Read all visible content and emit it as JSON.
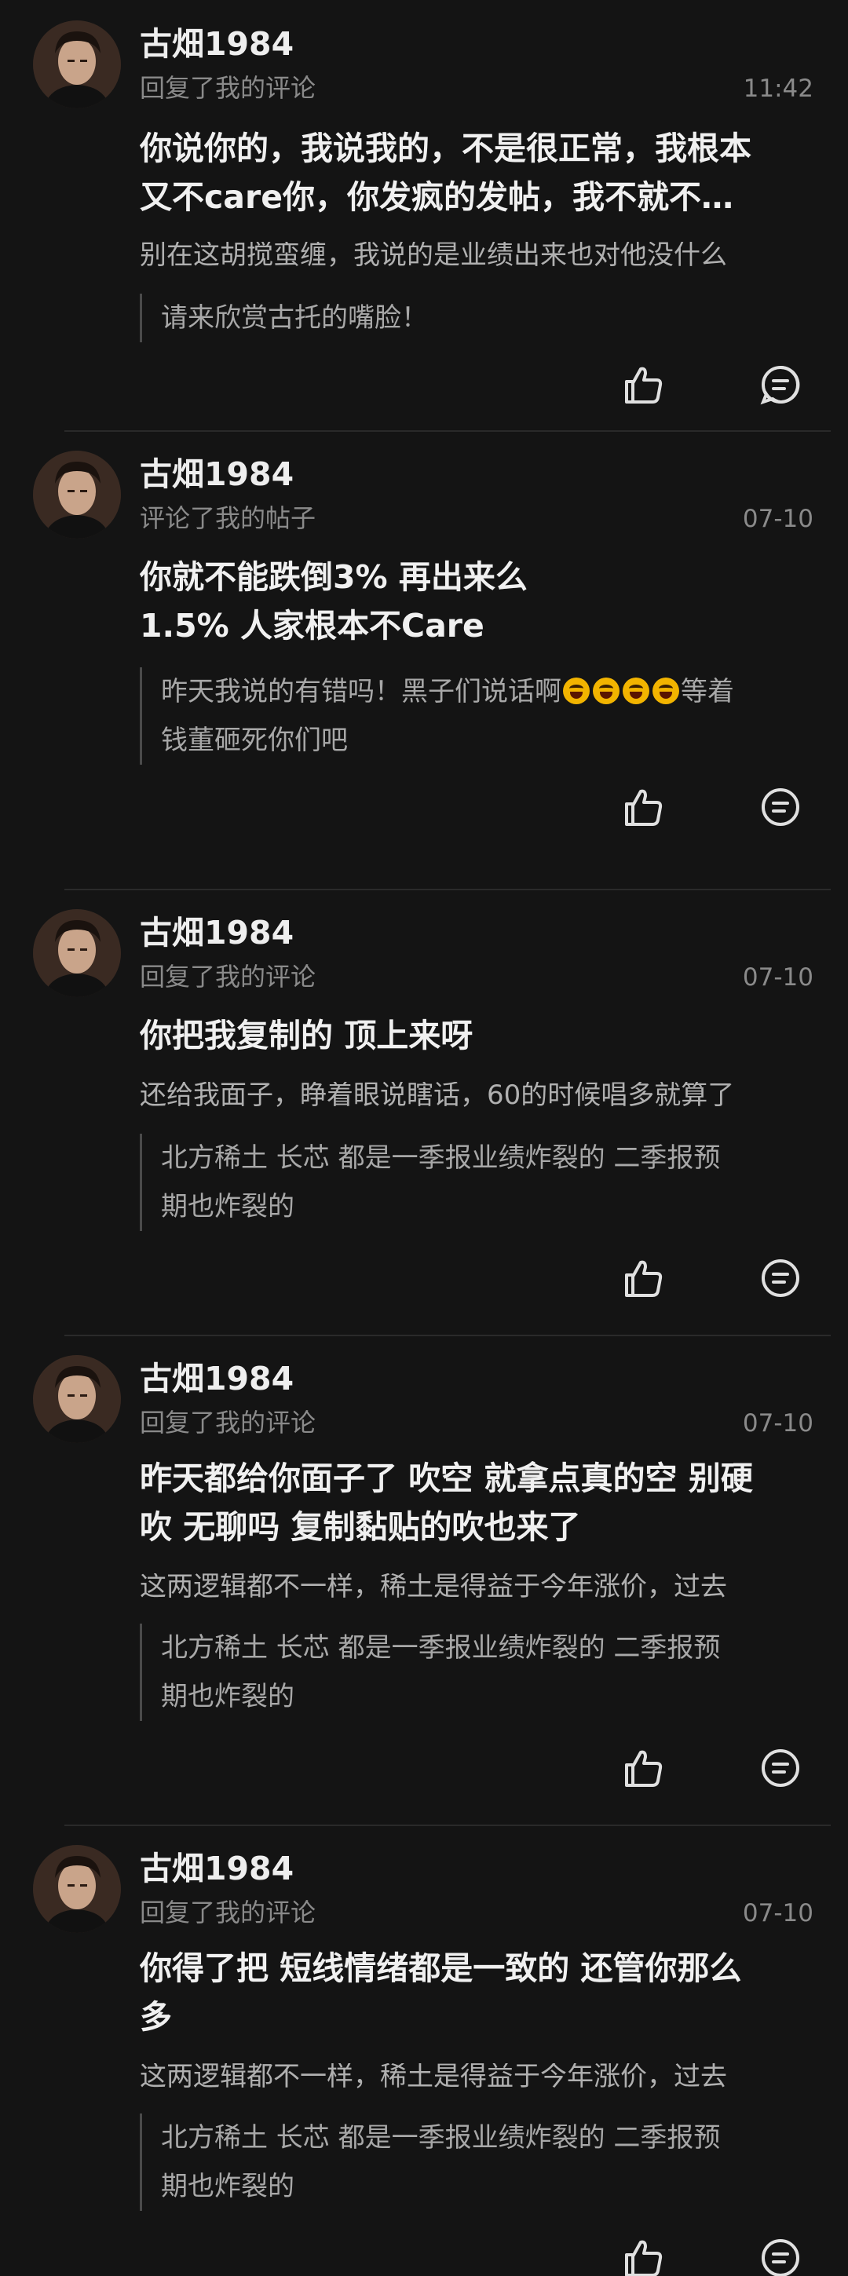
{
  "comments": [
    {
      "username": "古畑1984",
      "action": "回复了我的评论",
      "time": "11:42",
      "main_lines": [
        "你说你的，我说我的，不是很正常，我根本",
        "又不care你，你发疯的发帖，我不就不…"
      ],
      "context": "别在这胡搅蛮缠，我说的是业绩出来也对他没什么",
      "quote_lines": [
        "请来欣赏古托的嘴脸！"
      ]
    },
    {
      "username": "古畑1984",
      "action": "评论了我的帖子",
      "time": "07-10",
      "main_lines": [
        "你就不能跌倒3% 再出来么",
        "1.5% 人家根本不Care"
      ],
      "context": "",
      "quote_line1_text": "昨天我说的有错吗！黑子们说话啊",
      "quote_line1_tail": "等着",
      "quote_lines": [
        "昨天我说的有错吗！黑子们说话啊等着",
        "钱董砸死你们吧"
      ]
    },
    {
      "username": "古畑1984",
      "action": "回复了我的评论",
      "time": "07-10",
      "main_lines": [
        "你把我复制的 顶上来呀"
      ],
      "context": "还给我面子，睁着眼说瞎话，60的时候唱多就算了",
      "quote_lines": [
        "北方稀土 长芯 都是一季报业绩炸裂的 二季报预",
        "期也炸裂的"
      ]
    },
    {
      "username": "古畑1984",
      "action": "回复了我的评论",
      "time": "07-10",
      "main_lines": [
        "昨天都给你面子了 吹空 就拿点真的空 别硬",
        "吹 无聊吗 复制黏贴的吹也来了"
      ],
      "context": "这两逻辑都不一样，稀土是得益于今年涨价，过去",
      "quote_lines": [
        "北方稀土 长芯 都是一季报业绩炸裂的 二季报预",
        "期也炸裂的"
      ]
    },
    {
      "username": "古畑1984",
      "action": "回复了我的评论",
      "time": "07-10",
      "main_lines": [
        "你得了把 短线情绪都是一致的 还管你那么",
        "多"
      ],
      "context": "这两逻辑都不一样，稀土是得益于今年涨价，过去",
      "quote_lines": [
        "北方稀土 长芯 都是一季报业绩炸裂的 二季报预",
        "期也炸裂的"
      ]
    }
  ],
  "icons": {
    "like": "thumbs-up-icon",
    "reply": "comment-bubble-icon"
  },
  "colors": {
    "background": "#141414",
    "text_primary": "#f0f0f0",
    "text_secondary": "#8a8a8a"
  }
}
